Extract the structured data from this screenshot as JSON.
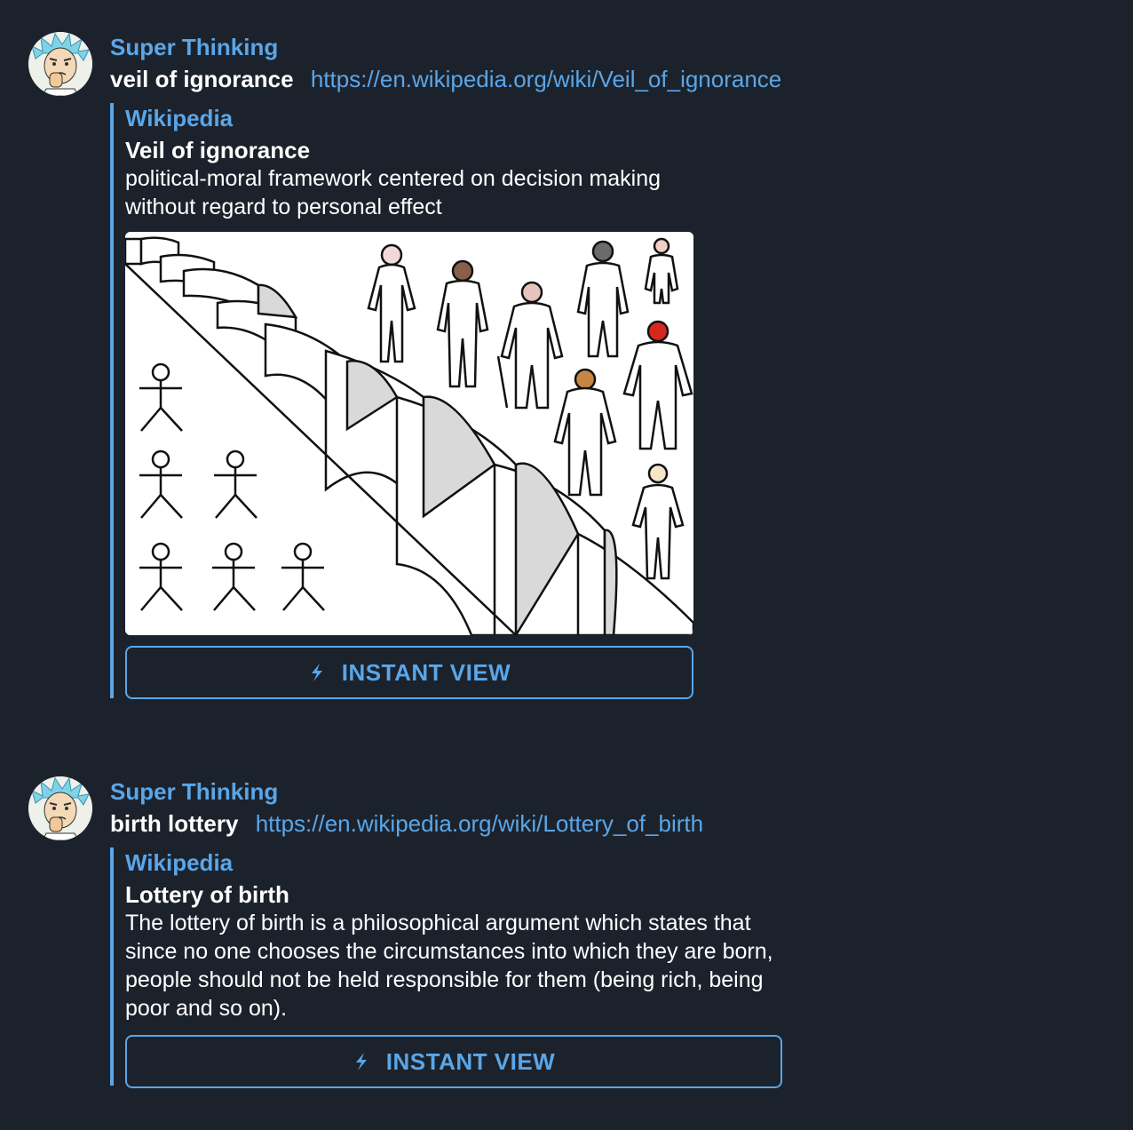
{
  "messages": [
    {
      "sender": "Super Thinking",
      "text": "veil of ignorance",
      "link": "https://en.wikipedia.org/wiki/Veil_of_ignorance",
      "preview": {
        "site_name": "Wikipedia",
        "title": "Veil of ignorance",
        "description": "political-moral framework centered on decision making without regard to personal effect",
        "button_label": "INSTANT VIEW"
      }
    },
    {
      "sender": "Super Thinking",
      "text": "birth lottery",
      "link": "https://en.wikipedia.org/wiki/Lottery_of_birth",
      "preview": {
        "site_name": "Wikipedia",
        "title": "Lottery of birth",
        "description": "The lottery of birth is a philosophical argument which states that since no one chooses the circumstances into which they are born, people should not be held responsible for them (being rich, being poor and so on).",
        "button_label": "INSTANT VIEW"
      }
    }
  ],
  "colors": {
    "background": "#1c222c",
    "accent": "#5aa6e8",
    "text": "#ffffff"
  },
  "icons": {
    "avatar": "cartoon-scientist-avatar",
    "instant_view": "lightning-bolt-icon"
  }
}
